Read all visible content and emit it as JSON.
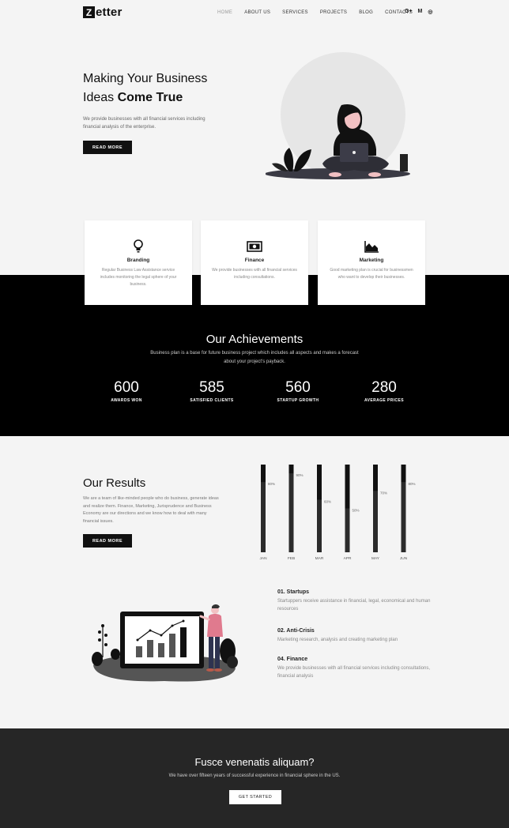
{
  "nav": {
    "logo_mark": "Z",
    "logo_text": "etter",
    "items": [
      "HOME",
      "ABOUT US",
      "SERVICES",
      "PROJECTS",
      "BLOG",
      "CONTACTS"
    ],
    "socials": [
      "G+",
      "M",
      "◎"
    ]
  },
  "hero": {
    "title_line1": "Making Your Business",
    "title_line2_a": "Ideas ",
    "title_line2_b": "Come True",
    "description": "We provide businesses with all financial services including financial analysis of the enterprise.",
    "button": "READ MORE"
  },
  "services": [
    {
      "title": "Branding",
      "text": "Regular Business Law Assistance service includes monitoring the legal sphere of your business.",
      "icon": "lightbulb-icon"
    },
    {
      "title": "Finance",
      "text": "We provide businesses with all financial services including consultations.",
      "icon": "banknote-icon"
    },
    {
      "title": "Marketing",
      "text": "Good marketing plan is crucial for businessmen who want to develop their businesses.",
      "icon": "area-chart-icon"
    }
  ],
  "achievements": {
    "title": "Our Achievements",
    "subtitle": "Business plan is a base for future business project which includes all aspects and makes a forecast about your project's payback.",
    "stats": [
      {
        "number": "600",
        "label": "AWARDS WON"
      },
      {
        "number": "585",
        "label": "SATISFIED CLIENTS"
      },
      {
        "number": "560",
        "label": "STARTUP GROWTH"
      },
      {
        "number": "280",
        "label": "AVERAGE PRICES"
      }
    ]
  },
  "results": {
    "title": "Our Results",
    "text": "We are a team of like-minded people who do business, generate ideas and realize them. Finance, Marketing, Jurisprudence and Business Economy are our directions and we know how to deal with many financial issues.",
    "button": "READ MORE",
    "colors": {
      "track": "#111111",
      "fill": "#2b2b2b"
    }
  },
  "chart_data": {
    "type": "bar",
    "categories": [
      "JAN",
      "FEB",
      "MAR",
      "APR",
      "MAY",
      "JUN"
    ],
    "values": [
      80,
      90,
      60,
      50,
      70,
      80
    ],
    "value_labels": [
      "80%",
      "90%",
      "60%",
      "50%",
      "70%",
      "80%"
    ],
    "ylim": [
      0,
      100
    ]
  },
  "features": [
    {
      "title": "01. Startups",
      "text": "Startuppers receive assistance in financial, legal, economical and human resources"
    },
    {
      "title": "02. Anti-Crisis",
      "text": "Marketing research, analysis and creating marketing plan"
    },
    {
      "title": "04. Finance",
      "text": "We provide businesses with all financial services including consultations, financial analysis"
    }
  ],
  "cta": {
    "title": "Fusce venenatis aliquam?",
    "subtitle": "We have over fifteen years of successful experience in financial sphere in the US.",
    "button": "GET STARTED"
  }
}
